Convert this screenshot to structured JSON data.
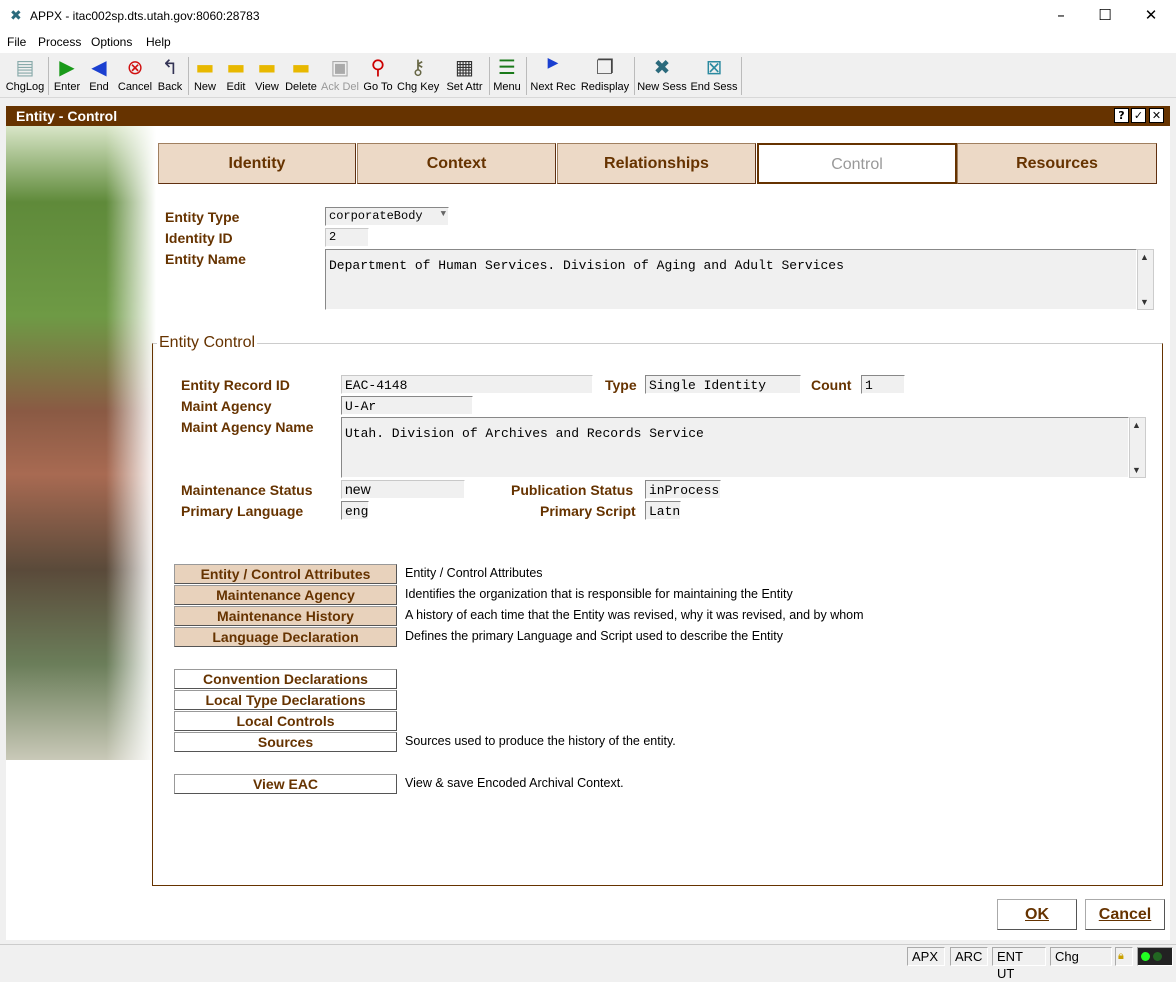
{
  "window": {
    "title": "APPX - itac002sp.dts.utah.gov:8060:28783",
    "minimize": "–",
    "maximize": "☐",
    "close": "✕"
  },
  "menu": [
    "File",
    "Process",
    "Options",
    "Help"
  ],
  "toolbar": [
    {
      "label": "ChgLog",
      "icon": "changelog-icon"
    },
    {
      "label": "Enter",
      "icon": "play-icon"
    },
    {
      "label": "End",
      "icon": "back-icon"
    },
    {
      "label": "Cancel",
      "icon": "cancel-icon"
    },
    {
      "label": "Back",
      "icon": "back-arrow-icon"
    },
    {
      "label": "New",
      "icon": "new-folder-icon"
    },
    {
      "label": "Edit",
      "icon": "edit-folder-icon"
    },
    {
      "label": "View",
      "icon": "view-folder-icon"
    },
    {
      "label": "Delete",
      "icon": "delete-folder-icon"
    },
    {
      "label": "Ack Del",
      "icon": "ack-delete-icon"
    },
    {
      "label": "Go To",
      "icon": "search-icon"
    },
    {
      "label": "Chg Key",
      "icon": "key-icon"
    },
    {
      "label": "Set Attr",
      "icon": "set-attr-icon"
    },
    {
      "label": "Menu",
      "icon": "menu-icon"
    },
    {
      "label": "Next Rec",
      "icon": "next-icon"
    },
    {
      "label": "Redisplay",
      "icon": "redisplay-icon"
    },
    {
      "label": "New Sess",
      "icon": "new-session-icon"
    },
    {
      "label": "End Sess",
      "icon": "end-session-icon"
    }
  ],
  "form": {
    "title": "Entity - Control",
    "title_buttons": [
      "?",
      "✓",
      "✕"
    ],
    "tabs": [
      "Identity",
      "Context",
      "Relationships",
      "Control",
      "Resources"
    ],
    "active_tab": "Control",
    "entity_type_label": "Entity Type",
    "entity_type_value": "corporateBody",
    "identity_id_label": "Identity ID",
    "identity_id_value": "2",
    "entity_name_label": "Entity Name",
    "entity_name_value": "Department of Human Services. Division of Aging and Adult Services"
  },
  "control": {
    "group_title": "Entity Control",
    "record_id_label": "Entity Record ID",
    "record_id_value": "EAC-4148",
    "type_label": "Type",
    "type_value": "Single Identity",
    "count_label": "Count",
    "count_value": "1",
    "maint_agency_label": "Maint Agency",
    "maint_agency_value": "U-Ar",
    "maint_agency_name_label": "Maint Agency Name",
    "maint_agency_name_value": "Utah. Division of Archives and Records Service",
    "maint_status_label": "Maintenance Status",
    "maint_status_value": "new",
    "pub_status_label": "Publication Status",
    "pub_status_value": "inProcess",
    "primary_lang_label": "Primary Language",
    "primary_lang_value": "eng",
    "primary_script_label": "Primary Script",
    "primary_script_value": "Latn"
  },
  "actions": [
    {
      "label": "Entity / Control Attributes",
      "desc": "Entity / Control Attributes",
      "style": "tan"
    },
    {
      "label": "Maintenance Agency",
      "desc": "Identifies the organization that is responsible for maintaining the Entity",
      "style": "tan"
    },
    {
      "label": "Maintenance History",
      "desc": "A history of each time that the Entity was revised, why it was revised, and by whom",
      "style": "tan"
    },
    {
      "label": "Language Declaration",
      "desc": "Defines the primary Language and Script used to describe the Entity",
      "style": "tan"
    },
    {
      "label": "Convention Declarations",
      "desc": "",
      "style": "white"
    },
    {
      "label": "Local Type Declarations",
      "desc": "",
      "style": "white"
    },
    {
      "label": "Local Controls",
      "desc": "",
      "style": "white"
    },
    {
      "label": "Sources",
      "desc": "Sources used to produce the history of the entity.",
      "style": "white"
    },
    {
      "label": "View EAC",
      "desc": "View & save Encoded Archival Context.",
      "style": "white"
    }
  ],
  "buttons": {
    "ok": "OK",
    "cancel": "Cancel"
  },
  "statusbar": [
    "APX",
    "ARC",
    "ENT UT",
    "Chg"
  ],
  "colors": {
    "accent": "#663300",
    "tab_bg": "#ecd9c6",
    "button_tan": "#e8d2bc"
  }
}
